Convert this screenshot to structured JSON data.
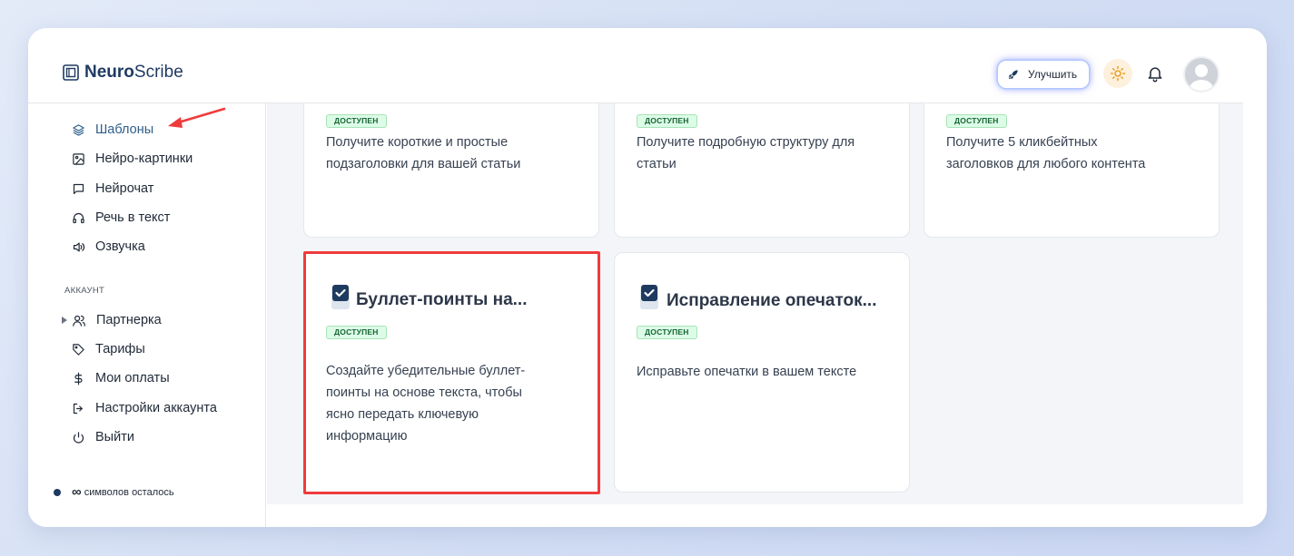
{
  "app": {
    "logo_bold": "Neuro",
    "logo_light": "Scribe"
  },
  "header": {
    "upgrade_label": "Улучшить"
  },
  "sidebar": {
    "items": [
      {
        "label": "Шаблоны",
        "icon": "layers-icon",
        "active": true
      },
      {
        "label": "Нейро-картинки",
        "icon": "image-icon"
      },
      {
        "label": "Нейрочат",
        "icon": "chat-icon"
      },
      {
        "label": "Речь в текст",
        "icon": "headphones-icon"
      },
      {
        "label": "Озвучка",
        "icon": "speaker-icon"
      }
    ],
    "account_label": "АККАУНТ",
    "account_items": [
      {
        "label": "Партнерка",
        "icon": "users-icon"
      },
      {
        "label": "Тарифы",
        "icon": "tag-icon"
      },
      {
        "label": "Мои оплаты",
        "icon": "dollar-icon"
      },
      {
        "label": "Настройки аккаунта",
        "icon": "logout-arrow-icon"
      },
      {
        "label": "Выйти",
        "icon": "power-icon"
      }
    ],
    "credits_symbol": "∞",
    "credits_text": "символов осталось"
  },
  "cards": [
    {
      "badge": "ДОСТУПЕН",
      "desc_lines": [
        "Получите короткие и простые",
        "подзаголовки для вашей статьи"
      ]
    },
    {
      "badge": "ДОСТУПЕН",
      "desc_lines": [
        "Получите подробную структуру для",
        "статьи"
      ]
    },
    {
      "badge": "ДОСТУПЕН",
      "desc_lines": [
        "Получите 5 кликбейтных",
        "заголовков для любого контента"
      ]
    },
    {
      "title": "Буллет-поинты на...",
      "badge": "ДОСТУПЕН",
      "desc_lines": [
        "Создайте убедительные буллет-",
        "поинты на основе текста, чтобы",
        "ясно передать ключевую",
        "информацию"
      ]
    },
    {
      "title": "Исправление опечаток...",
      "badge": "ДОСТУПЕН",
      "desc_lines": [
        "Исправьте опечатки в вашем тексте"
      ]
    }
  ],
  "colors": {
    "accent": "#2f5e8a",
    "highlight": "#ef3b3b",
    "badge_bg": "#dcfce7",
    "badge_text": "#166534"
  }
}
